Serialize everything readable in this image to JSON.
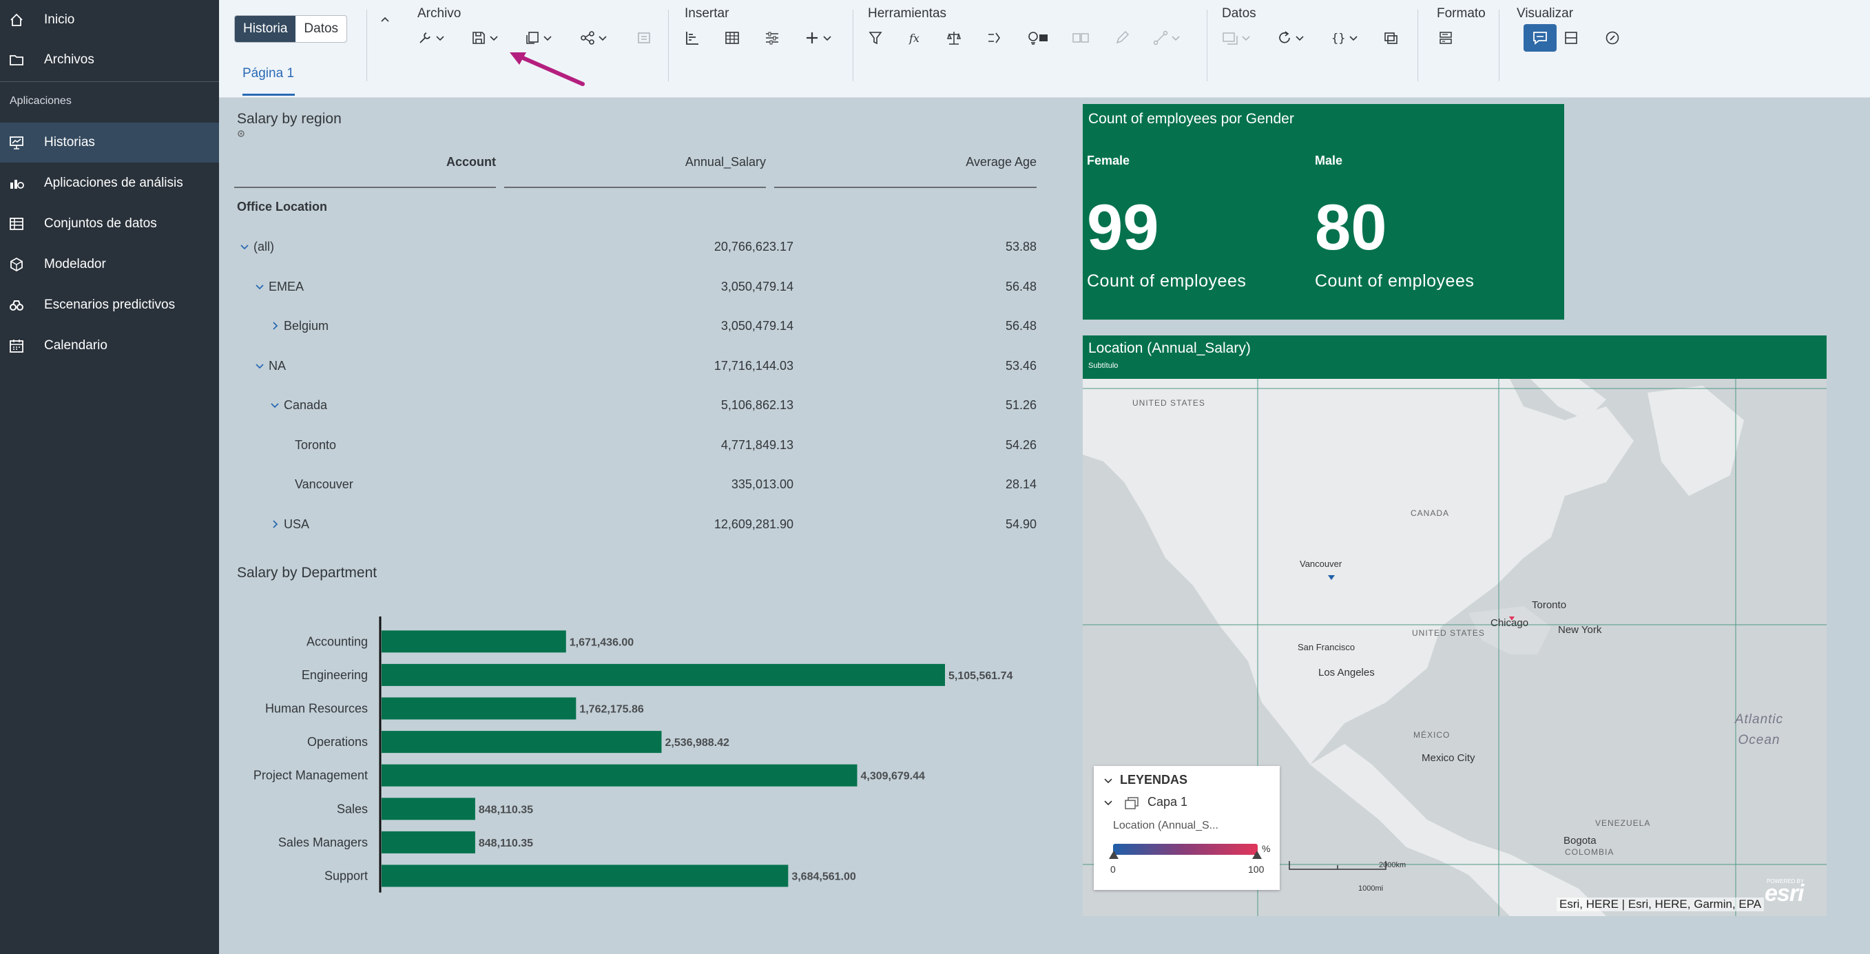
{
  "nav": {
    "items": [
      {
        "label": "Inicio",
        "icon": "home-icon"
      },
      {
        "label": "Archivos",
        "icon": "folder-icon"
      }
    ],
    "section_label": "Aplicaciones",
    "apps": [
      {
        "label": "Historias",
        "icon": "story-icon",
        "active": true
      },
      {
        "label": "Aplicaciones de análisis",
        "icon": "analytics-icon"
      },
      {
        "label": "Conjuntos de datos",
        "icon": "dataset-icon"
      },
      {
        "label": "Modelador",
        "icon": "modeler-icon"
      },
      {
        "label": "Escenarios predictivos",
        "icon": "binoculars-icon"
      },
      {
        "label": "Calendario",
        "icon": "calendar-icon"
      }
    ]
  },
  "toolbar": {
    "mode_story": "Historia",
    "mode_data": "Datos",
    "groups": {
      "archivo": "Archivo",
      "insertar": "Insertar",
      "herramientas": "Herramientas",
      "datos": "Datos",
      "formato": "Formato",
      "visualizar": "Visualizar"
    },
    "page_tab": "Página 1"
  },
  "table_widget": {
    "title": "Salary by region",
    "columns": [
      "Account",
      "Annual_Salary",
      "Average Age"
    ],
    "dimension_label": "Office Location",
    "rows": [
      {
        "label": "(all)",
        "indent": 0,
        "toggle": "expanded",
        "salary": "20,766,623.17",
        "age": "53.88"
      },
      {
        "label": "EMEA",
        "indent": 1,
        "toggle": "expanded",
        "salary": "3,050,479.14",
        "age": "56.48"
      },
      {
        "label": "Belgium",
        "indent": 2,
        "toggle": "collapsed",
        "salary": "3,050,479.14",
        "age": "56.48"
      },
      {
        "label": "NA",
        "indent": 1,
        "toggle": "expanded",
        "salary": "17,716,144.03",
        "age": "53.46"
      },
      {
        "label": "Canada",
        "indent": 2,
        "toggle": "expanded",
        "salary": "5,106,862.13",
        "age": "51.26"
      },
      {
        "label": "Toronto",
        "indent": 3,
        "toggle": "none",
        "salary": "4,771,849.13",
        "age": "54.26"
      },
      {
        "label": "Vancouver",
        "indent": 3,
        "toggle": "none",
        "salary": "335,013.00",
        "age": "28.14"
      },
      {
        "label": "USA",
        "indent": 2,
        "toggle": "collapsed",
        "salary": "12,609,281.90",
        "age": "54.90"
      }
    ]
  },
  "chart_data": {
    "type": "bar",
    "orientation": "horizontal",
    "title": "Salary by Department",
    "categories": [
      "Accounting",
      "Engineering",
      "Human Resources",
      "Operations",
      "Project Management",
      "Sales",
      "Sales Managers",
      "Support"
    ],
    "values": [
      1671436.0,
      5105561.74,
      1762175.86,
      2536988.42,
      4309679.44,
      848110.35,
      848110.35,
      3684561.0
    ],
    "value_labels": [
      "1,671,436.00",
      "5,105,561.74",
      "1,762,175.86",
      "2,536,988.42",
      "4,309,679.44",
      "848,110.35",
      "848,110.35",
      "3,684,561.00"
    ],
    "color": "#05724d",
    "grid": false
  },
  "kpi": {
    "title": "Count of employees por Gender",
    "items": [
      {
        "category": "Female",
        "value": "99",
        "measure": "Count of employees"
      },
      {
        "category": "Male",
        "value": "80",
        "measure": "Count of employees"
      }
    ]
  },
  "map": {
    "title": "Location (Annual_Salary)",
    "subtitle": "Subtítulo",
    "labels": {
      "us_north": "UNITED STATES",
      "canada": "CANADA",
      "us_mid": "UNITED STATES",
      "mexico": "MÉXICO",
      "venezuela": "VENEZUELA",
      "colombia": "COLOMBIA",
      "vancouver": "Vancouver",
      "toronto": "Toronto",
      "chicago": "Chicago",
      "new_york": "New York",
      "san_francisco": "San Francisco",
      "los_angeles": "Los Angeles",
      "mexico_city": "Mexico City",
      "bogota": "Bogota",
      "ocean": "Atlantic Ocean",
      "scale_km": "2000km",
      "scale_mi": "1000mi"
    },
    "legend": {
      "heading": "LEYENDAS",
      "layer": "Capa 1",
      "field": "Location (Annual_S...",
      "min": "0",
      "max": "100",
      "unit": "%",
      "gradient_colors": [
        "#1f5fa8",
        "#8a3d78",
        "#e0365a"
      ]
    },
    "attribution": "Esri, HERE | Esri, HERE, Garmin, EPA",
    "brand": "esri",
    "brand_tag": "POWERED BY"
  },
  "colors": {
    "nav_bg": "#29313a",
    "nav_active": "#354a5f",
    "accent_green": "#05724d",
    "accent_blue": "#2a6ab3",
    "canvas_bg": "#c3d0d7"
  }
}
